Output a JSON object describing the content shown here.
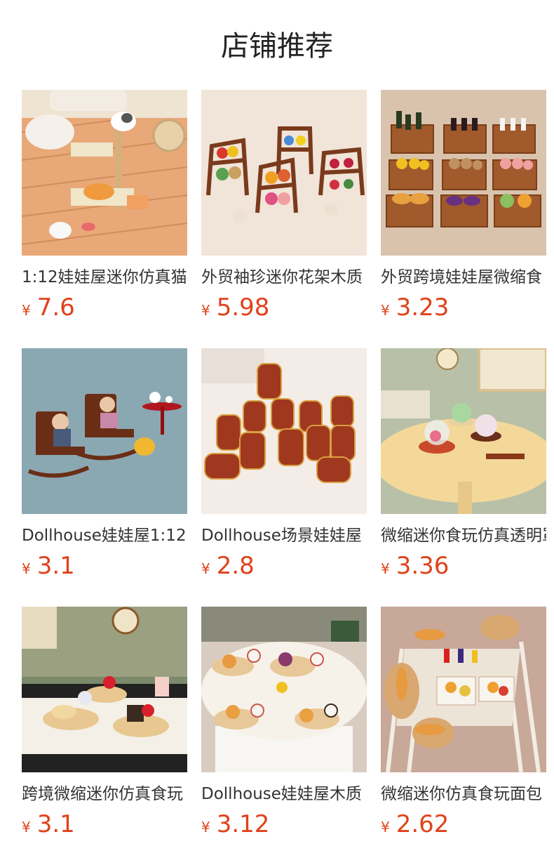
{
  "page": {
    "title": "店铺推荐"
  },
  "products": [
    {
      "name": "1:12娃娃屋迷你仿真猫",
      "currency": "¥",
      "price": "7.6"
    },
    {
      "name": "外贸袖珍迷你花架木质",
      "currency": "¥",
      "price": "5.98"
    },
    {
      "name": "外贸跨境娃娃屋微缩食",
      "currency": "¥",
      "price": "3.23"
    },
    {
      "name": "Dollhouse娃娃屋1:12",
      "currency": "¥",
      "price": "3.1"
    },
    {
      "name": "Dollhouse场景娃娃屋",
      "currency": "¥",
      "price": "2.8"
    },
    {
      "name": "微缩迷你食玩仿真透明罩",
      "currency": "¥",
      "price": "3.36"
    },
    {
      "name": "跨境微缩迷你仿真食玩",
      "currency": "¥",
      "price": "3.1"
    },
    {
      "name": "Dollhouse娃娃屋木质",
      "currency": "¥",
      "price": "3.12"
    },
    {
      "name": "微缩迷你仿真食玩面包",
      "currency": "¥",
      "price": "2.62"
    }
  ]
}
